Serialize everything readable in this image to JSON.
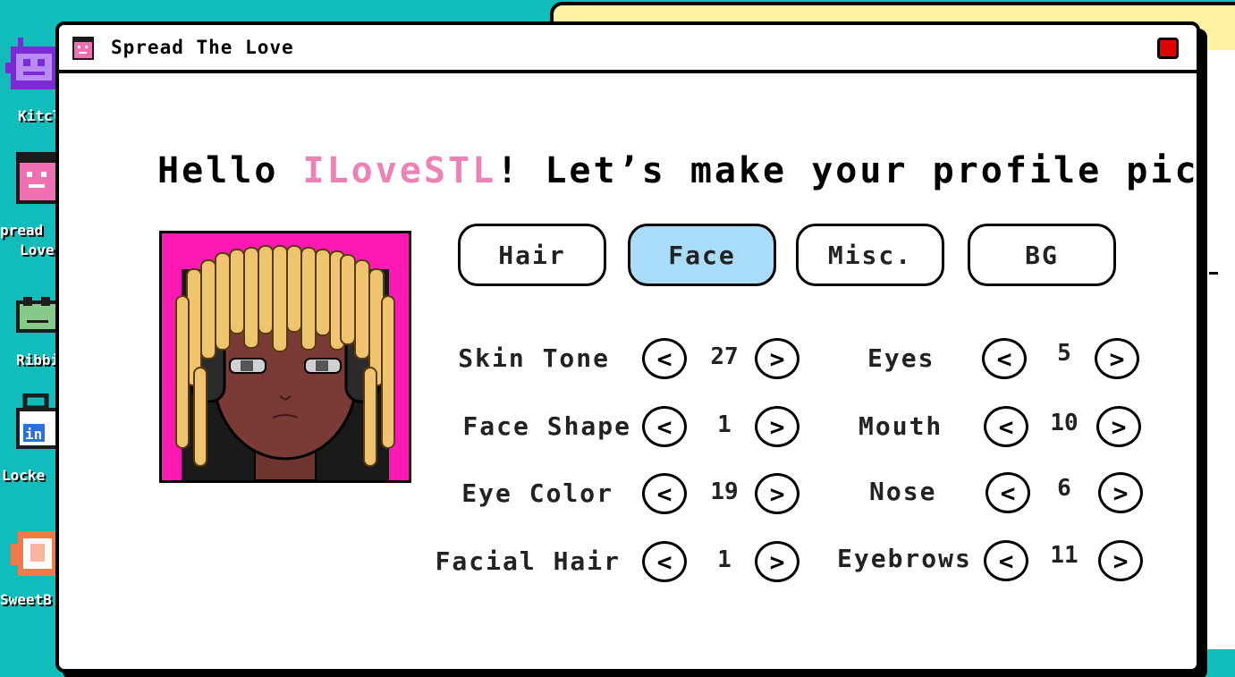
{
  "window": {
    "title": "Spread The Love"
  },
  "greeting": {
    "prefix": "Hello ",
    "username": "ILoveSTL",
    "suffix": "!  Let’s make your profile picture."
  },
  "tabs": [
    {
      "label": "Hair",
      "active": false
    },
    {
      "label": "Face",
      "active": true
    },
    {
      "label": "Misc.",
      "active": false
    },
    {
      "label": "BG",
      "active": false
    }
  ],
  "left_options": [
    {
      "label": "Skin Tone",
      "value": "27"
    },
    {
      "label": "Face Shape",
      "value": "1"
    },
    {
      "label": "Eye Color",
      "value": "19"
    },
    {
      "label": "Facial Hair",
      "value": "1"
    }
  ],
  "right_options": [
    {
      "label": "Eyes",
      "value": "5"
    },
    {
      "label": "Mouth",
      "value": "10"
    },
    {
      "label": "Nose",
      "value": "6"
    },
    {
      "label": "Eyebrows",
      "value": "11"
    }
  ],
  "arrows": {
    "prev": "<",
    "next": ">"
  },
  "desktop_icons": [
    {
      "label": "Kitcl",
      "icon": "kitchen-icon"
    },
    {
      "label": "pread",
      "label2": "Love",
      "icon": "spread-the-love-icon"
    },
    {
      "label": "Ribbi",
      "icon": "ribbit-frog-icon"
    },
    {
      "label": "Locke",
      "icon": "locked-in-bag-icon"
    },
    {
      "label": "SweetB",
      "icon": "sweet-bakery-icon"
    }
  ],
  "colors": {
    "desktop": "#10bdbb",
    "username": "#ee82b6",
    "active_tab": "#a8dcf8",
    "avatar_bg": "#ff19b4",
    "close": "#e00000"
  }
}
